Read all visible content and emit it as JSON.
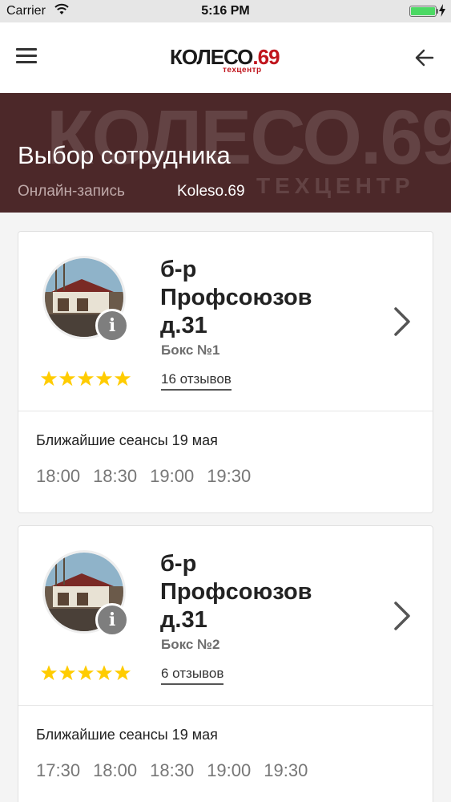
{
  "status_bar": {
    "carrier": "Carrier",
    "time": "5:16 PM",
    "battery_color": "#4cd964"
  },
  "nav": {
    "logo_main": "КОЛЕСО",
    "logo_num": ".69",
    "logo_sub": "техцентр",
    "menu_icon": "hamburger-icon",
    "back_icon": "arrow-left-icon"
  },
  "hero": {
    "title": "Выбор сотрудника",
    "subtitle": "Онлайн-запись",
    "brand": "Koleso.69",
    "background_color": "#4c2829",
    "watermark_main": "КОЛЕСО.69",
    "watermark_sub": "ТЕХЦЕНТР"
  },
  "employees": [
    {
      "name_line1": "б-р",
      "name_line2": "Профсоюзов",
      "name_line3": "д.31",
      "box": "Бокс №1",
      "reviews": "16 отзывов",
      "rating_stars": 5,
      "slots_title": "Ближайшие сеансы 19 мая",
      "slots": [
        "18:00",
        "18:30",
        "19:00",
        "19:30"
      ]
    },
    {
      "name_line1": "б-р",
      "name_line2": "Профсоюзов",
      "name_line3": "д.31",
      "box": "Бокс №2",
      "reviews": "6 отзывов",
      "rating_stars": 5,
      "slots_title": "Ближайшие сеансы 19 мая",
      "slots": [
        "17:30",
        "18:00",
        "18:30",
        "19:00",
        "19:30"
      ]
    }
  ],
  "colors": {
    "star": "#ffcc00",
    "accent_red": "#c0151d",
    "info_badge": "#7e7e7e"
  }
}
